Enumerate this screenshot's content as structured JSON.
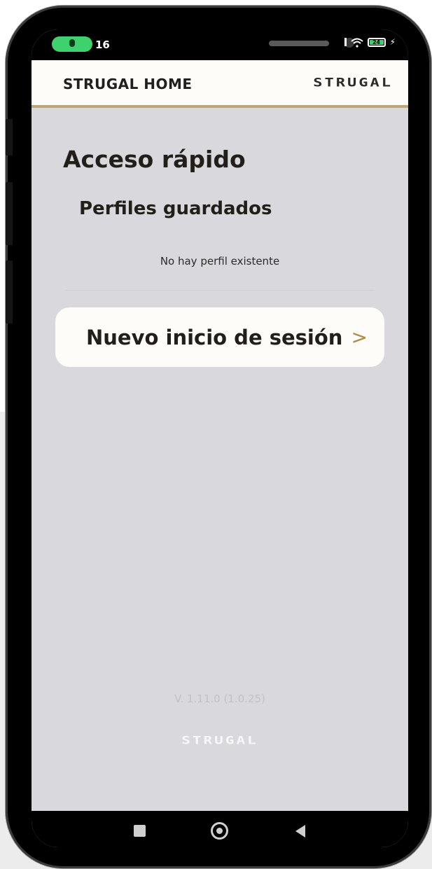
{
  "status_bar": {
    "clock": "16",
    "battery_level": "24",
    "icons": [
      "mic-icon",
      "signal-icon",
      "wifi-icon",
      "battery-icon",
      "charging-icon"
    ],
    "mic_color": "#3ed16d"
  },
  "app_bar": {
    "title": "STRUGAL HOME",
    "logo_text": "STRUGAL",
    "accent_color": "#bea678"
  },
  "main": {
    "section_title": "Acceso rápido",
    "saved_profiles_title": "Perfiles guardados",
    "empty_message": "No hay perfil existente",
    "new_login_label": "Nuevo inicio de sesión",
    "chevron_color": "#b48a3c"
  },
  "footer": {
    "version": "V. 1.11.0 (1.0.25)",
    "logo_text": "STRUGAL"
  },
  "nav_bar": {
    "icons": [
      "recents-icon",
      "home-icon",
      "back-icon"
    ]
  }
}
